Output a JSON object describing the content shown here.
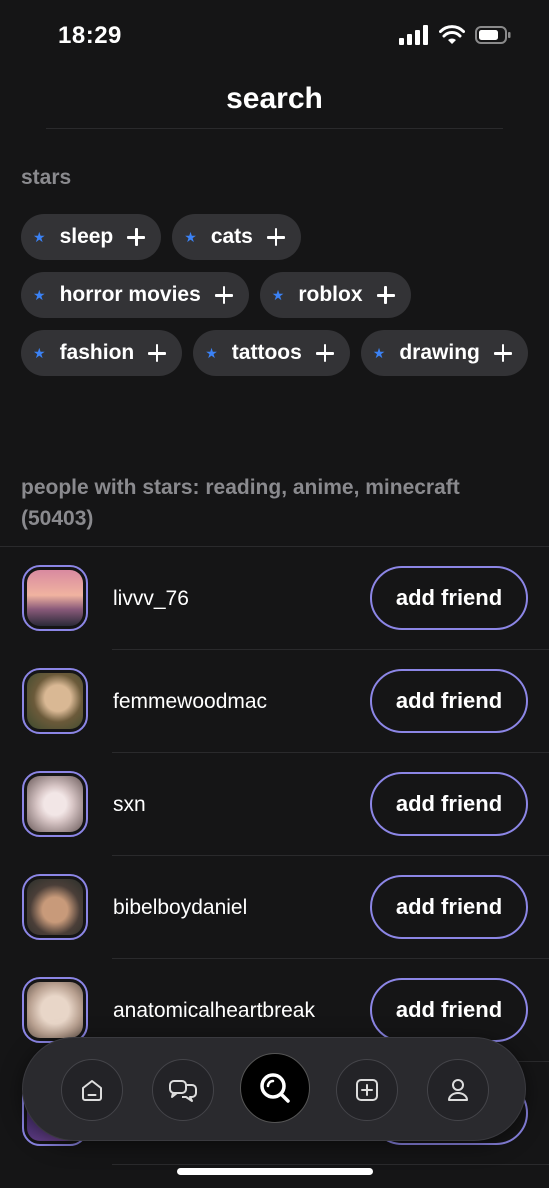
{
  "status_bar": {
    "time": "18:29"
  },
  "header": {
    "title": "search"
  },
  "stars_section": {
    "label": "stars",
    "chips": [
      {
        "label": "sleep"
      },
      {
        "label": "cats"
      },
      {
        "label": "horror movies"
      },
      {
        "label": "roblox"
      },
      {
        "label": "fashion"
      },
      {
        "label": "tattoos"
      },
      {
        "label": "drawing"
      }
    ],
    "star_color": "#3b82f6"
  },
  "people_section": {
    "heading": "people with stars: reading, anime, minecraft (50403)",
    "people": [
      {
        "username": "livvv_76",
        "action": "add friend"
      },
      {
        "username": "femmewoodmac",
        "action": "add friend"
      },
      {
        "username": "sxn",
        "action": "add friend"
      },
      {
        "username": "bibelboydaniel",
        "action": "add friend"
      },
      {
        "username": "anatomicalheartbreak",
        "action": "add friend"
      },
      {
        "username": "",
        "action": ""
      }
    ]
  },
  "tab_bar": {
    "tabs": [
      {
        "icon": "home-icon",
        "active": false
      },
      {
        "icon": "chat-icon",
        "active": false
      },
      {
        "icon": "search-icon",
        "active": true
      },
      {
        "icon": "add-post-icon",
        "active": false
      },
      {
        "icon": "profile-icon",
        "active": false
      }
    ]
  },
  "colors": {
    "background": "#151516",
    "accent": "#8c86e6",
    "chip_bg": "#333336",
    "muted_text": "#8a8a8e"
  }
}
